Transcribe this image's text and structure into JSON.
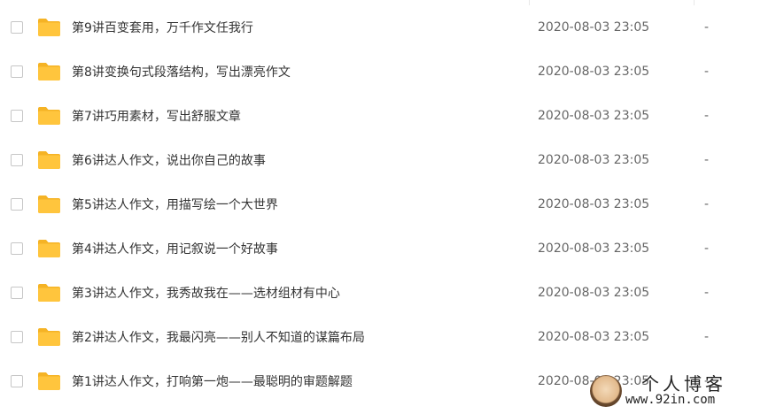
{
  "folders": [
    {
      "name": "第9讲百变套用，万千作文任我行",
      "date": "2020-08-03 23:05",
      "size": "-"
    },
    {
      "name": "第8讲变换句式段落结构，写出漂亮作文",
      "date": "2020-08-03 23:05",
      "size": "-"
    },
    {
      "name": "第7讲巧用素材，写出舒服文章",
      "date": "2020-08-03 23:05",
      "size": "-"
    },
    {
      "name": "第6讲达人作文，说出你自己的故事",
      "date": "2020-08-03 23:05",
      "size": "-"
    },
    {
      "name": "第5讲达人作文，用描写绘一个大世界",
      "date": "2020-08-03 23:05",
      "size": "-"
    },
    {
      "name": "第4讲达人作文，用记叙说一个好故事",
      "date": "2020-08-03 23:05",
      "size": "-"
    },
    {
      "name": "第3讲达人作文，我秀故我在——选材组材有中心",
      "date": "2020-08-03 23:05",
      "size": "-"
    },
    {
      "name": "第2讲达人作文，我最闪亮——别人不知道的谋篇布局",
      "date": "2020-08-03 23:05",
      "size": "-"
    },
    {
      "name": "第1讲达人作文，打响第一炮——最聪明的审题解题",
      "date": "2020-08-03 23:05",
      "size": "-"
    }
  ],
  "watermark": {
    "title": "个人博客",
    "url": "www.92in.com"
  },
  "colors": {
    "folder": "#ffc53d",
    "folder_tab": "#f5b325",
    "text": "#333333",
    "meta_text": "#666666"
  }
}
